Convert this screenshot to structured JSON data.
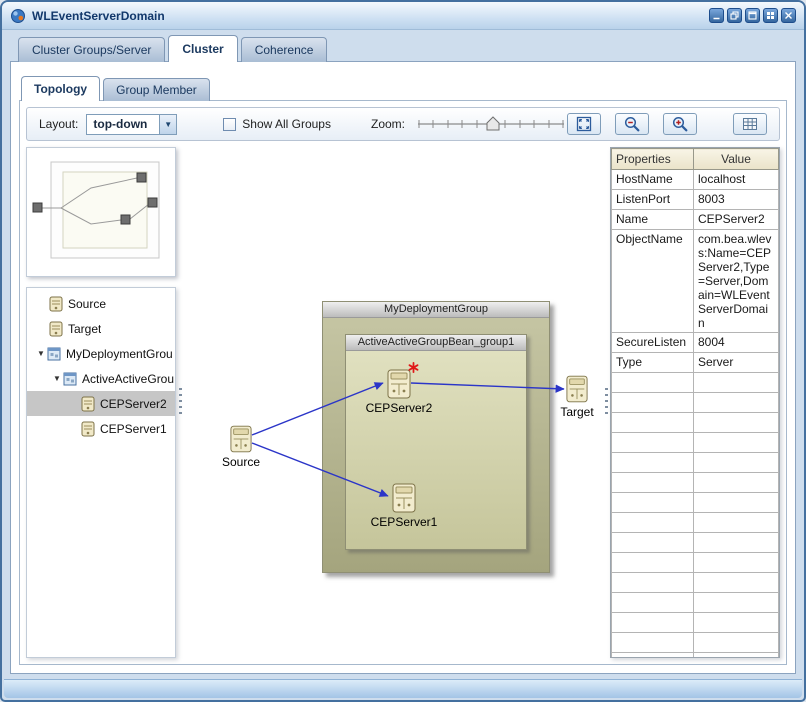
{
  "window": {
    "title": "WLEventServerDomain",
    "buttons": [
      "minimize",
      "restore",
      "maximize",
      "tile",
      "close"
    ]
  },
  "tabs": {
    "items": [
      {
        "label": "Cluster Groups/Server",
        "active": false
      },
      {
        "label": "Cluster",
        "active": true
      },
      {
        "label": "Coherence",
        "active": false
      }
    ]
  },
  "subtabs": {
    "items": [
      {
        "label": "Topology",
        "active": true
      },
      {
        "label": "Group Member",
        "active": false
      }
    ]
  },
  "toolbar": {
    "layout_label": "Layout:",
    "layout_value": "top-down",
    "show_all_groups_label": "Show All Groups",
    "show_all_groups_checked": false,
    "zoom_label": "Zoom:",
    "buttons": [
      "fit-to-window",
      "zoom-out",
      "zoom-in",
      "grid-view"
    ]
  },
  "tree": {
    "items": [
      {
        "label": "Source",
        "icon": "server-icon"
      },
      {
        "label": "Target",
        "icon": "server-icon"
      },
      {
        "label": "MyDeploymentGrou",
        "icon": "group-icon",
        "expanded": true
      },
      {
        "label": "ActiveActiveGrou",
        "icon": "group-icon",
        "expanded": true
      },
      {
        "label": "CEPServer2",
        "icon": "server-icon",
        "selected": true
      },
      {
        "label": "CEPServer1",
        "icon": "server-icon"
      }
    ]
  },
  "diagram": {
    "group_title": "MyDeploymentGroup",
    "inner_group_title": "ActiveActiveGroupBean_group1",
    "nodes": {
      "source": "Source",
      "target": "Target",
      "server2": "CEPServer2",
      "server1": "CEPServer1"
    }
  },
  "properties_table": {
    "columns": [
      "Properties",
      "Value"
    ],
    "rows": [
      {
        "name": "HostName",
        "value": "localhost"
      },
      {
        "name": "ListenPort",
        "value": "8003"
      },
      {
        "name": "Name",
        "value": "CEPServer2"
      },
      {
        "name": "ObjectName",
        "value": "com.bea.wlevs:Name=CEPServer2,Type=Server,Domain=WLEventServerDomain"
      },
      {
        "name": "SecureListen",
        "value": "8004"
      },
      {
        "name": "Type",
        "value": "Server"
      }
    ],
    "empty_row_count": 15
  },
  "colors": {
    "connection_line": "#2b35c8",
    "selected_row": "#c6c6c6",
    "group_body": "#b7b78c",
    "inner_group_body": "#d6d6a8",
    "accent_blue": "#3a6ea5"
  }
}
